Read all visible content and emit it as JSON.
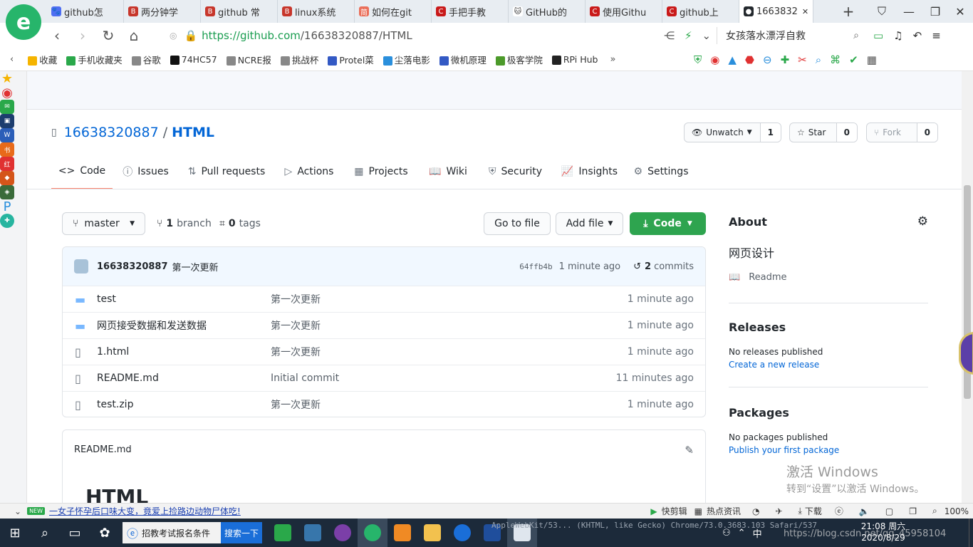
{
  "browser": {
    "logo": "e",
    "tabs": [
      {
        "label": "github怎",
        "color": "#4e6ef2",
        "glyph": "🐾"
      },
      {
        "label": "两分钟学",
        "color": "#c7362b",
        "glyph": "B"
      },
      {
        "label": "github 常",
        "color": "#c7362b",
        "glyph": "B"
      },
      {
        "label": "linux系统",
        "color": "#c7362b",
        "glyph": "B"
      },
      {
        "label": "如何在git",
        "color": "#ea6f5a",
        "glyph": "简"
      },
      {
        "label": "手把手教",
        "color": "#c91a1a",
        "glyph": "C"
      },
      {
        "label": "GitHub的",
        "color": "#ffffff",
        "glyph": "🐱"
      },
      {
        "label": "使用Githu",
        "color": "#c91a1a",
        "glyph": "C"
      },
      {
        "label": "github上",
        "color": "#c91a1a",
        "glyph": "C"
      },
      {
        "label": "1663832",
        "color": "#24292e",
        "glyph": "●"
      }
    ],
    "new_tab": "+",
    "window_controls": [
      "⛉",
      "—",
      "❐",
      "✕"
    ],
    "url_prefix": "https://",
    "url_host": "github.com",
    "url_path": "/16638320887/HTML",
    "search_hint": "女孩落水漂浮自救",
    "bookmarks": [
      {
        "label": "收藏",
        "color": "#f5b400"
      },
      {
        "label": "手机收藏夹",
        "color": "#2aa84a"
      },
      {
        "label": "谷歌",
        "color": "#888888"
      },
      {
        "label": "74HC57",
        "color": "#111111"
      },
      {
        "label": "NCRE报",
        "color": "#888888"
      },
      {
        "label": "挑战杯",
        "color": "#888888"
      },
      {
        "label": "Protel菜",
        "color": "#3359c4"
      },
      {
        "label": "尘落电影",
        "color": "#2a8fdc"
      },
      {
        "label": "微机原理",
        "color": "#3359c4"
      },
      {
        "label": "极客学院",
        "color": "#4c9a2a"
      },
      {
        "label": "RPi Hub",
        "color": "#222222"
      }
    ],
    "bookmarks_more": "»"
  },
  "repo": {
    "owner": "16638320887",
    "separator": "/",
    "name": "HTML",
    "unwatch_label": "Unwatch",
    "watch_count": "1",
    "star_label": "Star",
    "star_count": "0",
    "fork_label": "Fork",
    "fork_count": "0"
  },
  "tabs": [
    {
      "label": "Code",
      "icon": "<>"
    },
    {
      "label": "Issues",
      "icon": "ⓘ"
    },
    {
      "label": "Pull requests",
      "icon": "⇅"
    },
    {
      "label": "Actions",
      "icon": "▷"
    },
    {
      "label": "Projects",
      "icon": "▦"
    },
    {
      "label": "Wiki",
      "icon": "📖"
    },
    {
      "label": "Security",
      "icon": "⛨"
    },
    {
      "label": "Insights",
      "icon": "📈"
    },
    {
      "label": "Settings",
      "icon": "⚙"
    }
  ],
  "branch": {
    "current": "master",
    "branch_count": "1",
    "branch_label": "branch",
    "tag_count": "0",
    "tag_label": "tags",
    "go_to_file": "Go to file",
    "add_file": "Add file",
    "code": "Code"
  },
  "commit": {
    "author": "16638320887",
    "message": "第一次更新",
    "sha": "64ffb4b",
    "time": "1 minute ago",
    "count": "2",
    "count_label": "commits"
  },
  "files": [
    {
      "name": "test",
      "type": "folder",
      "message": "第一次更新",
      "time": "1 minute ago"
    },
    {
      "name": "网页接受数据和发送数据",
      "type": "folder",
      "message": "第一次更新",
      "time": "1 minute ago"
    },
    {
      "name": "1.html",
      "type": "file",
      "message": "第一次更新",
      "time": "1 minute ago"
    },
    {
      "name": "README.md",
      "type": "file",
      "message": "Initial commit",
      "time": "11 minutes ago"
    },
    {
      "name": "test.zip",
      "type": "file",
      "message": "第一次更新",
      "time": "1 minute ago"
    }
  ],
  "readme": {
    "filename": "README.md",
    "heading": "HTML"
  },
  "about": {
    "title": "About",
    "description": "网页设计",
    "readme": "Readme",
    "releases_title": "Releases",
    "releases_text": "No releases published",
    "releases_link": "Create a new release",
    "packages_title": "Packages",
    "packages_text": "No packages published",
    "packages_link": "Publish your first package"
  },
  "watermark": {
    "line1": "激活 Windows",
    "line2": "转到“设置”以激活 Windows。"
  },
  "statusbar": {
    "news_badge": "NEW",
    "news": "一女子怀孕后口味大变，竟爱上捡路边动物尸体吃!",
    "quick_edit": "快剪辑",
    "hot_news": "热点资讯",
    "download": "下载",
    "zoom": "100%"
  },
  "taskbar": {
    "search_text": "招教考试报名条件",
    "search_btn": "搜索一下",
    "user_agent": "AppleWebKit/53... (KHTML, like Gecko) Chrome/73.0.3683.103 Safari/537",
    "ime": "中",
    "time": "21:08 周六",
    "date": "2020/8/29",
    "watermark_url": "https://blog.csdn.net/qq_45958104"
  }
}
